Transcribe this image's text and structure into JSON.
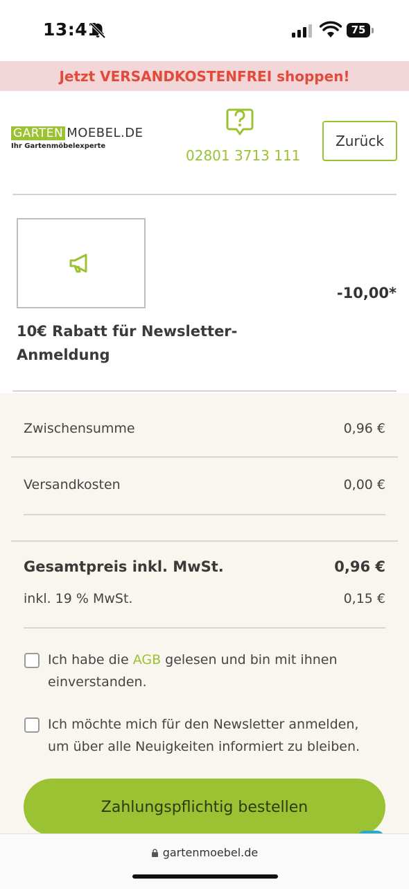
{
  "status_bar": {
    "time": "13:41",
    "battery": "75",
    "bell_icon": "bell-muted-icon",
    "signal_icon": "cell-signal-icon",
    "wifi_icon": "wifi-icon"
  },
  "promo": {
    "text": "Jetzt VERSANDKOSTENFREI shoppen!",
    "bg": "#f2d6d8",
    "color": "#e24b3c"
  },
  "header": {
    "logo_part1": "GARTEN",
    "logo_part2": "MOEBEL.DE",
    "logo_tagline": "Ihr Gartenmöbelexperte",
    "help_icon": "question-chat-icon",
    "phone": "02801 3713 111",
    "back_label": "Zurück",
    "accent": "#9bc233"
  },
  "product": {
    "icon": "megaphone-icon",
    "price": "-10,00*",
    "title": "10€ Rabatt für Newsletter-Anmeldung"
  },
  "summary": {
    "subtotal_label": "Zwischensumme",
    "subtotal_value": "0,96 €",
    "shipping_label": "Versandkosten",
    "shipping_value": "0,00 €",
    "total_label": "Gesamtpreis inkl. MwSt.",
    "total_value": "0,96 €",
    "vat_label": "inkl. 19 % MwSt.",
    "vat_value": "0,15 €"
  },
  "agreements": {
    "agb_before": "Ich habe die ",
    "agb_link": "AGB",
    "agb_after": " gelesen und bin mit ihnen",
    "agb_line2": "einverstanden.",
    "newsletter_line1": "Ich möchte mich für den Newsletter anmelden,",
    "newsletter_line2": "um über alle Neuigkeiten informiert zu bleiben."
  },
  "order_button": {
    "label": "Zahlungspflichtig bestellen",
    "bg": "#9bc233"
  },
  "browser": {
    "url": "gartenmoebel.de",
    "lock_icon": "lock-icon"
  }
}
